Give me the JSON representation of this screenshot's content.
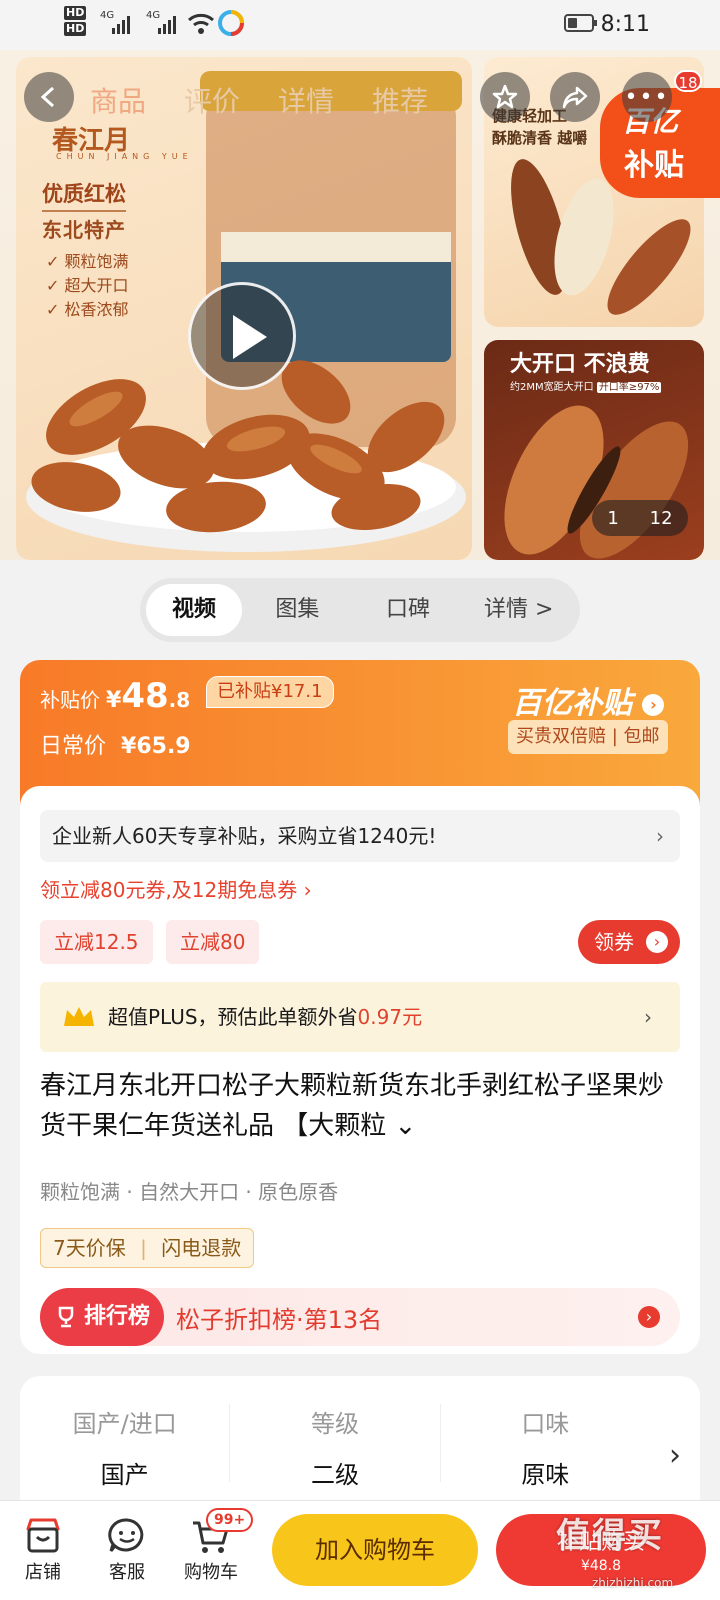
{
  "status_bar": {
    "hd1": "HD",
    "hd2": "HD",
    "net1": "4G",
    "net2": "4G",
    "time": "8:11"
  },
  "top_nav": {
    "tabs": [
      "商品",
      "评价",
      "详情",
      "推荐"
    ],
    "cart_count": "18"
  },
  "gallery": {
    "brand": "春江月",
    "brand_pinyin": "CHUN JIANG YUE",
    "headline1": "优质红松",
    "headline2": "东北特产",
    "features": [
      "颗粒饱满",
      "超大开口",
      "松香浓郁"
    ],
    "side1_text1": "健康轻加工",
    "side1_text2": "酥脆清香 越嚼",
    "side2_title": "大开口 不浪费",
    "side2_sub": "约2MM宽距大开口",
    "side2_badge": "开口率≥97%",
    "pager_current": "1",
    "pager_total": "12",
    "corner_badge_line1": "百亿",
    "corner_badge_line2": "补贴"
  },
  "media_tabs": {
    "items": [
      "视频",
      "图集",
      "口碑",
      "详情 >"
    ],
    "selected": "视频"
  },
  "price": {
    "subsidy_label": "补贴价",
    "currency": "¥",
    "subsidy_int": "48",
    "subsidy_dec": ".8",
    "subsidized_tag": "已补贴¥17.1",
    "regular_label": "日常价",
    "regular_price": "¥65.9",
    "program_name": "百亿补贴",
    "guarantee": "买贵双倍赔 | 包邮"
  },
  "promo": {
    "enterprise_text": "企业新人60天专享补贴，采购立省1240元!",
    "coupon_link": "领立减80元券,及12期免息券 ›",
    "pills": [
      "立减12.5",
      "立减80"
    ],
    "get_coupon": "领券",
    "plus_text": "超值PLUS，预估此单额外省",
    "plus_amount": "0.97元"
  },
  "product": {
    "title": "春江月东北开口松子大颗粒新货东北手剥红松子坚果炒货干果仁年货送礼品 【大颗粒 ⌄",
    "tags": "颗粒饱满 · 自然大开口 · 原色原香",
    "guarantee_1": "7天价保",
    "guarantee_2": "闪电退款",
    "rank_label": "排行榜",
    "rank_text": "松子折扣榜·第13名"
  },
  "specs": [
    {
      "key": "国产/进口",
      "value": "国产"
    },
    {
      "key": "等级",
      "value": "二级"
    },
    {
      "key": "口味",
      "value": "原味"
    }
  ],
  "bottom_bar": {
    "shop": "店铺",
    "service": "客服",
    "cart": "购物车",
    "cart_badge": "99+",
    "add_to_cart": "加入购物车",
    "buy_label": "补贴购买",
    "buy_price": "¥48.8",
    "watermark": "值得买",
    "watermark_url": "zhizhizhi.com"
  },
  "colors": {
    "accent": "#ef3a33",
    "orange": "#f87a28",
    "yellow": "#f8c61b"
  }
}
